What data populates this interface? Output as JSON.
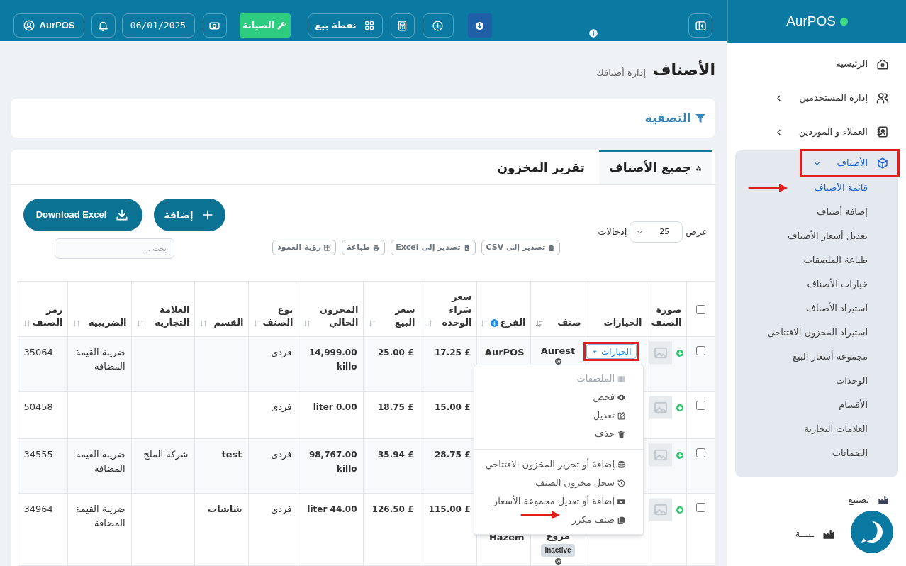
{
  "brand": {
    "name": "AurPOS",
    "online": true
  },
  "topbar": {
    "user": "AurPOS",
    "date": "06/01/2025",
    "maintenance": "الصيانة",
    "pos": "نقطة بيع"
  },
  "sidebar": {
    "items": [
      {
        "kind": "link",
        "label": "الرئيسية",
        "selected": false
      },
      {
        "kind": "group",
        "label": "إدارة المستخدمين",
        "selected": false,
        "expanded": false
      },
      {
        "kind": "group",
        "label": "العملاء و الموردين",
        "selected": false,
        "expanded": false
      },
      {
        "kind": "group",
        "label": "الأصناف",
        "selected": true,
        "expanded": true,
        "children": [
          {
            "label": "قائمة الأصناف",
            "selected": true
          },
          {
            "label": "إضافة أصناف",
            "selected": false
          },
          {
            "label": "تعديل أسعار الأصناف",
            "selected": false
          },
          {
            "label": "طباعة الملصقات",
            "selected": false
          },
          {
            "label": "خيارات الأصناف",
            "selected": false
          },
          {
            "label": "استيراد الأصناف",
            "selected": false
          },
          {
            "label": "استيراد المخزون الافتتاحى",
            "selected": false
          },
          {
            "label": "مجموعة أسعار البيع",
            "selected": false
          },
          {
            "label": "الوحدات",
            "selected": false
          },
          {
            "label": "الأقسام",
            "selected": false
          },
          {
            "label": "العلامات التجارية",
            "selected": false
          },
          {
            "label": "الضمانات",
            "selected": false
          }
        ]
      },
      {
        "kind": "link",
        "label": "تصنيع",
        "selected": false
      },
      {
        "kind": "link",
        "label": "ـبـــة",
        "selected": false
      }
    ]
  },
  "page": {
    "title": "الأصناف",
    "subtitle": "إدارة أصنافك",
    "filter": "التصفية"
  },
  "tabs": [
    {
      "label": "جميع الأصناف",
      "selected": true
    },
    {
      "label": "تقرير المخزون",
      "selected": false
    }
  ],
  "entries": {
    "prefix": "عرض",
    "value": "25",
    "suffix": "إدخالات"
  },
  "export_buttons": [
    "تصدير إلى CSV",
    "تصدير إلى Excel",
    "طباعة",
    "رؤية العمود"
  ],
  "add_button": "إضافة",
  "download_button": "Download Excel",
  "search": {
    "placeholder": "بحث ..."
  },
  "table": {
    "select_all": false,
    "columns": [
      {
        "label": "صورة الصنف",
        "kind": "plain",
        "info": false
      },
      {
        "label": "الخيارات",
        "kind": "plain",
        "info": false
      },
      {
        "label": "صنف",
        "kind": "sorted",
        "info": false
      },
      {
        "label": "الفرع",
        "kind": "sortable",
        "info": true
      },
      {
        "label": "سعر شراء الوحدة",
        "kind": "sortable",
        "info": false
      },
      {
        "label": "سعر البيع",
        "kind": "sortable",
        "info": false
      },
      {
        "label": "المخزون الحالي",
        "kind": "sortable",
        "info": false
      },
      {
        "label": "نوع الصنف",
        "kind": "sortable",
        "info": false
      },
      {
        "label": "القسم",
        "kind": "sortable",
        "info": false
      },
      {
        "label": "العلامة التجارية",
        "kind": "sortable",
        "info": false
      },
      {
        "label": "الضريبية",
        "kind": "sortable",
        "info": false
      },
      {
        "label": "رمز الصنف",
        "kind": "sortable",
        "info": false
      }
    ],
    "rows": [
      {
        "checked": false,
        "options": "الخيارات",
        "name": "Aurest",
        "branch": "AurPOS",
        "cost": "17.25 £",
        "price": "25.00 £",
        "stock": "14,999.00 killo",
        "type": "فردى",
        "tax": "ضريبة القيمة المضافة",
        "code": "35064"
      },
      {
        "checked": false,
        "cost": "15.00 £",
        "price": "18.75 £",
        "stock": "liter 0.00",
        "type": "فردى",
        "code": "50458"
      },
      {
        "checked": false,
        "cost": "28.75 £",
        "price": "35.94 £",
        "stock": "98,767.00 killo",
        "type": "فردى",
        "category": "test",
        "brand": "شركة الملح",
        "tax": "ضريبة القيمة المضافة",
        "code": "34555"
      },
      {
        "checked": false,
        "name": "مروع",
        "badge": "Inactive",
        "branch": "Hazem",
        "cost": "115.00 £",
        "price": "126.50 £",
        "stock": "liter 44.00",
        "type": "فردى",
        "category": "شاشات",
        "tax": "ضريبة القيمة المضافة",
        "code": "34964"
      }
    ]
  },
  "options_menu": {
    "groups": [
      {
        "items": [
          {
            "label": "الملصقات",
            "disabled": true
          },
          {
            "label": "فحص",
            "disabled": false
          },
          {
            "label": "تعديل",
            "disabled": false
          },
          {
            "label": "حذف",
            "disabled": false
          }
        ]
      },
      {
        "items": [
          {
            "label": "إضافة أو تحرير المخزون الافتتاحي",
            "disabled": false
          },
          {
            "label": "سجل مخزون الصنف",
            "disabled": false
          },
          {
            "label": "إضافة أو تعديل مجموعة الأسعار",
            "disabled": false
          },
          {
            "label": "صنف مكرر",
            "disabled": false
          }
        ]
      }
    ]
  }
}
